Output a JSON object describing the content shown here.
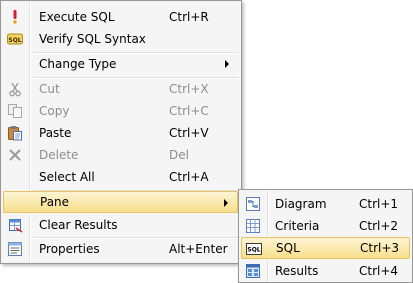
{
  "context_menu": {
    "items": [
      {
        "label": "Execute SQL",
        "shortcut": "Ctrl+R",
        "icon": "exclamation-icon"
      },
      {
        "label": "Verify SQL Syntax",
        "shortcut": "",
        "icon": "sql-verify-icon"
      },
      {
        "label": "Change Type",
        "shortcut": "",
        "icon": "none",
        "submenu": true
      },
      {
        "label": "Cut",
        "shortcut": "Ctrl+X",
        "icon": "scissors-icon",
        "disabled": true
      },
      {
        "label": "Copy",
        "shortcut": "Ctrl+C",
        "icon": "copy-icon",
        "disabled": true
      },
      {
        "label": "Paste",
        "shortcut": "Ctrl+V",
        "icon": "paste-icon"
      },
      {
        "label": "Delete",
        "shortcut": "Del",
        "icon": "delete-x-icon",
        "disabled": true
      },
      {
        "label": "Select All",
        "shortcut": "Ctrl+A",
        "icon": "none"
      },
      {
        "label": "Pane",
        "shortcut": "",
        "icon": "none",
        "submenu": true,
        "highlighted": true
      },
      {
        "label": "Clear Results",
        "shortcut": "",
        "icon": "clear-results-icon"
      },
      {
        "label": "Properties",
        "shortcut": "Alt+Enter",
        "icon": "properties-icon"
      }
    ]
  },
  "pane_submenu": {
    "items": [
      {
        "label": "Diagram",
        "shortcut": "Ctrl+1",
        "icon": "diagram-pane-icon"
      },
      {
        "label": "Criteria",
        "shortcut": "Ctrl+2",
        "icon": "criteria-grid-icon"
      },
      {
        "label": "SQL",
        "shortcut": "Ctrl+3",
        "icon": "sql-pane-icon",
        "highlighted": true
      },
      {
        "label": "Results",
        "shortcut": "Ctrl+4",
        "icon": "results-pane-icon"
      }
    ]
  },
  "colors": {
    "menu_background": "#f5f5f5",
    "menu_border": "#979797",
    "highlight_top": "#fdf4d3",
    "highlight_bottom": "#f8df8c",
    "highlight_border": "#e5c365",
    "disabled_text": "#8d8d8d"
  }
}
